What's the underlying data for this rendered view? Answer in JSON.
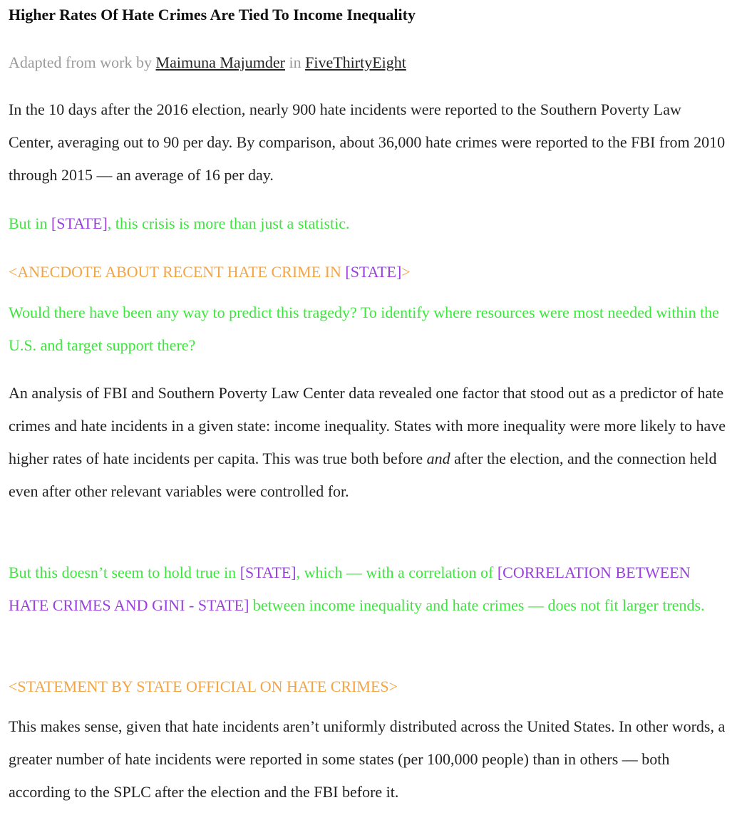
{
  "article": {
    "title": "Higher Rates Of Hate Crimes Are Tied To Income Inequality",
    "byline": {
      "prefix": "Adapted from work by",
      "author": "Maimuna Majumder",
      "connector": "in",
      "publication": "FiveThirtyEight"
    },
    "p1": "In the 10 days after the 2016 election, nearly 900 hate incidents were reported to the Southern Poverty Law Center, averaging out to 90 per day. By comparison, about 36,000 hate crimes were reported to the FBI from 2010 through 2015 — an average of 16 per day.",
    "p2": {
      "before": "But in ",
      "state": "[STATE]",
      "after": ", this crisis is more than just a statistic."
    },
    "p3": {
      "before": "<ANECDOTE ABOUT RECENT HATE CRIME IN ",
      "state": "[STATE]",
      "after": ">"
    },
    "p4": "Would there have been any way to predict this tragedy? To identify where resources were most needed within the U.S. and target support there?",
    "p5": {
      "before": "An analysis of FBI and Southern Poverty Law Center data revealed one factor that stood out as a predictor of hate crimes and hate incidents in a given state: income inequality. States with more inequality were more likely to have higher rates of hate incidents per capita. This was true both before ",
      "emph": "and",
      "after": " after the election, and the connection held even after other relevant variables were controlled for."
    },
    "p6": {
      "before": "But this doesn’t seem to hold true in ",
      "state": "[STATE]",
      "middle": ", which — with a correlation of ",
      "placeholder": "[CORRELATION BETWEEN HATE CRIMES AND GINI - STATE]",
      "after": " between income inequality and hate crimes — does not fit larger trends."
    },
    "p7": "<STATEMENT BY STATE OFFICIAL ON HATE CRIMES>",
    "p8": "This makes sense, given that hate incidents aren’t uniformly distributed across the United States. In other words, a greater number of hate incidents were reported in some states (per 100,000 people) than in others — both according to the SPLC after the election and the FBI before it."
  },
  "colors": {
    "green": "#3de63d",
    "purple": "#9b3fe0",
    "orange": "#f5a442",
    "byline_gray": "#9a9a9a"
  }
}
